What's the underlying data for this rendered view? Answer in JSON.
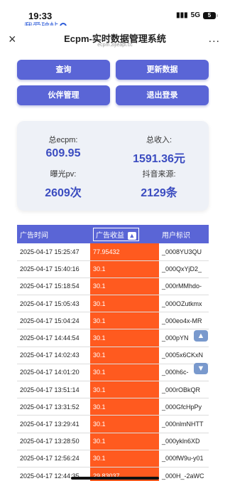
{
  "status": {
    "time": "19:33",
    "network": "5G",
    "battery": "5"
  },
  "watermark": {
    "text": "我爱破帖"
  },
  "nav": {
    "title": "Ecpm-实时数据管理系统",
    "url": "ecpm.zijieapi.cc",
    "close": "×",
    "more": "..."
  },
  "buttons": {
    "query": "查询",
    "update": "更新数据",
    "partner": "伙伴管理",
    "logout": "退出登录"
  },
  "stats": {
    "ecpm_label": "总ecpm:",
    "ecpm_value": "609.95",
    "income_label": "总收入:",
    "income_value": "1591.36元",
    "pv_label": "曝光pv:",
    "pv_value": "2609次",
    "source_label": "抖音来源:",
    "source_value": "2129条"
  },
  "table": {
    "headers": {
      "time": "广告时间",
      "revenue": "广告收益",
      "user": "用户标识"
    },
    "rows": [
      {
        "time": "2025-04-17 15:25:47",
        "revenue": "77.95432",
        "user": "_0008YU3QU"
      },
      {
        "time": "2025-04-17 15:40:16",
        "revenue": "30.1",
        "user": "_000QxYjD2_"
      },
      {
        "time": "2025-04-17 15:18:54",
        "revenue": "30.1",
        "user": "_000rMMhdo-"
      },
      {
        "time": "2025-04-17 15:05:43",
        "revenue": "30.1",
        "user": "_000OZutkmx"
      },
      {
        "time": "2025-04-17 15:04:24",
        "revenue": "30.1",
        "user": "_000eo4x-MR"
      },
      {
        "time": "2025-04-17 14:44:54",
        "revenue": "30.1",
        "user": "_000pYN"
      },
      {
        "time": "2025-04-17 14:02:43",
        "revenue": "30.1",
        "user": "_0005x6CKxN"
      },
      {
        "time": "2025-04-17 14:01:20",
        "revenue": "30.1",
        "user": "_000h6c-"
      },
      {
        "time": "2025-04-17 13:51:14",
        "revenue": "30.1",
        "user": "_000rOBkQR"
      },
      {
        "time": "2025-04-17 13:31:52",
        "revenue": "30.1",
        "user": "_000GfcHpPy"
      },
      {
        "time": "2025-04-17 13:29:41",
        "revenue": "30.1",
        "user": "_000nlmNHTT"
      },
      {
        "time": "2025-04-17 13:28:50",
        "revenue": "30.1",
        "user": "_000ykln6XD"
      },
      {
        "time": "2025-04-17 12:56:24",
        "revenue": "30.1",
        "user": "_000fW9u-y01"
      },
      {
        "time": "2025-04-17 12:44:35",
        "revenue": "29.83037",
        "user": "_000H_-2aWC"
      }
    ]
  },
  "colors": {
    "accent": "#5a65d6",
    "revenue_cell": "#ff5a1f",
    "stat_value": "#3b4cc0"
  },
  "icons": {
    "sort": "arrow-up-icon",
    "scroll_up": "scroll-up-icon",
    "scroll_down": "scroll-down-icon"
  }
}
